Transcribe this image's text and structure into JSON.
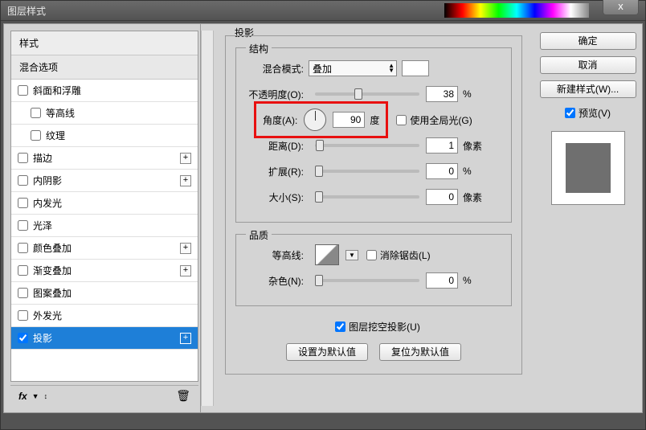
{
  "window": {
    "title": "图层样式"
  },
  "left": {
    "header1": "样式",
    "header2": "混合选项",
    "items": [
      {
        "label": "斜面和浮雕",
        "checked": false,
        "plus": false,
        "indent": false
      },
      {
        "label": "等高线",
        "checked": false,
        "plus": false,
        "indent": true
      },
      {
        "label": "纹理",
        "checked": false,
        "plus": false,
        "indent": true
      },
      {
        "label": "描边",
        "checked": false,
        "plus": true,
        "indent": false
      },
      {
        "label": "内阴影",
        "checked": false,
        "plus": true,
        "indent": false
      },
      {
        "label": "内发光",
        "checked": false,
        "plus": false,
        "indent": false
      },
      {
        "label": "光泽",
        "checked": false,
        "plus": false,
        "indent": false
      },
      {
        "label": "颜色叠加",
        "checked": false,
        "plus": true,
        "indent": false
      },
      {
        "label": "渐变叠加",
        "checked": false,
        "plus": true,
        "indent": false
      },
      {
        "label": "图案叠加",
        "checked": false,
        "plus": false,
        "indent": false
      },
      {
        "label": "外发光",
        "checked": false,
        "plus": false,
        "indent": false
      },
      {
        "label": "投影",
        "checked": true,
        "plus": true,
        "indent": false,
        "selected": true
      }
    ],
    "footer": {
      "fx": "fx"
    }
  },
  "center": {
    "title": "投影",
    "structure": {
      "title": "结构",
      "blend_label": "混合模式:",
      "blend_value": "叠加",
      "opacity_label": "不透明度(O):",
      "opacity_value": "38",
      "opacity_unit": "%",
      "angle_label": "角度(A):",
      "angle_value": "90",
      "angle_unit": "度",
      "global_label": "使用全局光(G)",
      "global_checked": false,
      "distance_label": "距离(D):",
      "distance_value": "1",
      "distance_unit": "像素",
      "spread_label": "扩展(R):",
      "spread_value": "0",
      "spread_unit": "%",
      "size_label": "大小(S):",
      "size_value": "0",
      "size_unit": "像素"
    },
    "quality": {
      "title": "品质",
      "contour_label": "等高线:",
      "antialias_label": "消除锯齿(L)",
      "antialias_checked": false,
      "noise_label": "杂色(N):",
      "noise_value": "0",
      "noise_unit": "%"
    },
    "knockout": {
      "label": "图层挖空投影(U)",
      "checked": true
    },
    "defaults": {
      "set": "设置为默认值",
      "reset": "复位为默认值"
    }
  },
  "right": {
    "ok": "确定",
    "cancel": "取消",
    "newstyle": "新建样式(W)...",
    "preview_label": "预览(V)",
    "preview_checked": true
  }
}
